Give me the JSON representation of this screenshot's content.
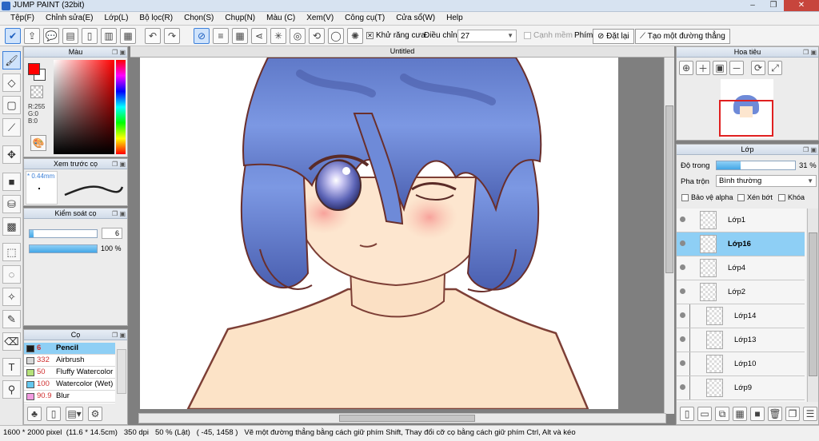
{
  "window": {
    "title": "JUMP PAINT (32bit)"
  },
  "menu": [
    "Tệp(F)",
    "Chỉnh sửa(E)",
    "Lớp(L)",
    "Bộ lọc(R)",
    "Chọn(S)",
    "Chụp(N)",
    "Màu (C)",
    "Xem(V)",
    "Công cụ(T)",
    "Cửa sổ(W)",
    "Help"
  ],
  "toolbar": {
    "antialias_label": "Khử răng cưa",
    "adjust_label": "Điều chỉnh",
    "adjust_value": "27",
    "edge_label": "Cạnh mềm",
    "key_label": "Phím",
    "reset_label": "Đặt lại",
    "line_label": "Tạo một đường thẳng"
  },
  "color_panel": {
    "title": "Màu",
    "r": "R:255",
    "g": "G:0",
    "b": "B:0",
    "fg": "#ff0000",
    "bg": "#ffffff"
  },
  "preview_panel": {
    "title": "Xem trước cọ",
    "size": "* 0.44mm"
  },
  "control_panel": {
    "title": "Kiểm soát cọ",
    "size_value": "6",
    "opacity_value": "100 %",
    "size_fraction": 0.06,
    "opacity_fraction": 1.0
  },
  "brush_panel": {
    "title": "Cọ",
    "items": [
      {
        "size": "6",
        "name": "Pencil",
        "color": "#1a1a1a",
        "selected": true
      },
      {
        "size": "332",
        "name": "Airbrush",
        "color": "#d8d8d8",
        "selected": false
      },
      {
        "size": "50",
        "name": "Fluffy Watercolor",
        "color": "#b6e27a",
        "selected": false
      },
      {
        "size": "100",
        "name": "Watercolor (Wet)",
        "color": "#64c8ef",
        "selected": false
      },
      {
        "size": "90.9",
        "name": "Blur",
        "color": "#f29ae0",
        "selected": false
      }
    ]
  },
  "canvas": {
    "tab_title": "Untitled"
  },
  "navigator": {
    "title": "Hoa tiêu"
  },
  "layer_panel": {
    "title": "Lớp",
    "opacity_label": "Độ trong",
    "opacity_value": "31 %",
    "opacity_fraction": 0.31,
    "blend_label": "Pha trộn",
    "blend_value": "Bình thường",
    "protect_alpha": "Bảo vệ alpha",
    "clipping": "Xén bớt",
    "lock": "Khóa",
    "layers": [
      {
        "name": "Lớp1",
        "selected": false,
        "indent": false
      },
      {
        "name": "Lớp16",
        "selected": true,
        "indent": false
      },
      {
        "name": "Lớp4",
        "selected": false,
        "indent": false
      },
      {
        "name": "Lớp2",
        "selected": false,
        "indent": false
      },
      {
        "name": "Lớp14",
        "selected": false,
        "indent": true
      },
      {
        "name": "Lớp13",
        "selected": false,
        "indent": true
      },
      {
        "name": "Lớp10",
        "selected": false,
        "indent": true
      },
      {
        "name": "Lớp9",
        "selected": false,
        "indent": true
      }
    ]
  },
  "status": {
    "dimensions": "1600 * 2000 pixel",
    "physical": "(11.6 * 14.5cm)",
    "dpi": "350 dpi",
    "zoom": "50 % (Lật)",
    "coords": "( -45, 1458 )",
    "hint": "Vẽ một đường thẳng bằng cách giữ phím Shift, Thay đổi cỡ cọ bằng cách giữ phím Ctrl, Alt và kéo"
  }
}
